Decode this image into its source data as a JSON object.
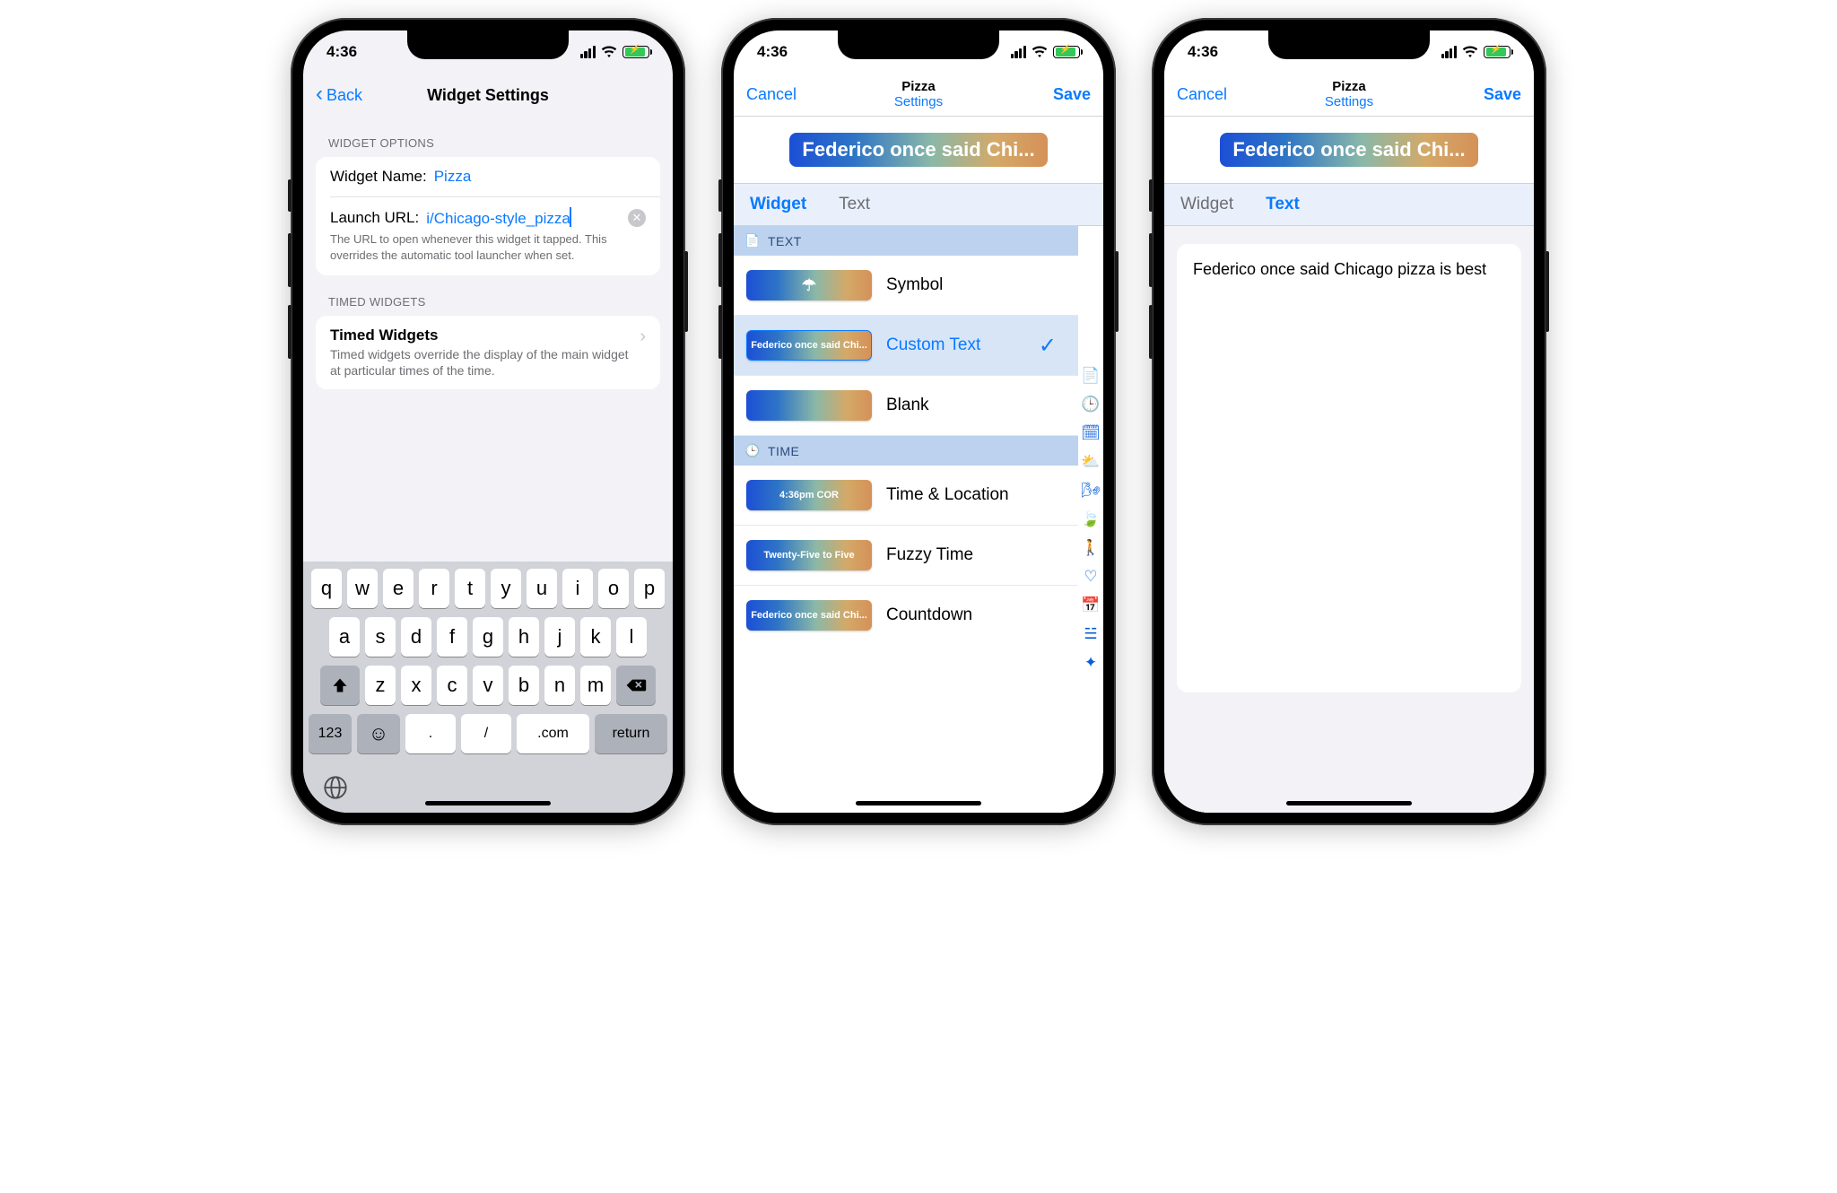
{
  "status": {
    "time": "4:36"
  },
  "phone1": {
    "back": "Back",
    "title": "Widget Settings",
    "section1": "WIDGET OPTIONS",
    "name_label": "Widget Name:",
    "name_value": "Pizza",
    "url_label": "Launch URL:",
    "url_value": "i/Chicago-style_pizza",
    "url_desc": "The URL to open whenever this widget it tapped. This overrides the automatic tool launcher when set.",
    "section2": "TIMED WIDGETS",
    "tw_title": "Timed Widgets",
    "tw_sub": "Timed widgets override the display of the main widget at particular times of the time.",
    "kb": {
      "r1": [
        "q",
        "w",
        "e",
        "r",
        "t",
        "y",
        "u",
        "i",
        "o",
        "p"
      ],
      "r2": [
        "a",
        "s",
        "d",
        "f",
        "g",
        "h",
        "j",
        "k",
        "l"
      ],
      "r3": [
        "z",
        "x",
        "c",
        "v",
        "b",
        "n",
        "m"
      ],
      "r4": {
        "num": "123",
        "dot": ".",
        "slash": "/",
        "com": ".com",
        "ret": "return"
      }
    }
  },
  "phone2": {
    "cancel": "Cancel",
    "save": "Save",
    "title": "Pizza",
    "subtitle": "Settings",
    "preview": "Federico once said Chi...",
    "tabs": {
      "widget": "Widget",
      "text": "Text"
    },
    "sec_text": "TEXT",
    "sec_time": "TIME",
    "rows": {
      "symbol": "Symbol",
      "custom": "Custom Text",
      "custom_thumb": "Federico once said Chi...",
      "blank": "Blank",
      "time_loc": "Time & Location",
      "time_loc_thumb": "4:36pm COR",
      "fuzzy": "Fuzzy Time",
      "fuzzy_thumb": "Twenty-Five to Five",
      "countdown": "Countdown",
      "countdown_thumb": "Federico once said Chi..."
    }
  },
  "phone3": {
    "cancel": "Cancel",
    "save": "Save",
    "title": "Pizza",
    "subtitle": "Settings",
    "preview": "Federico once said Chi...",
    "tabs": {
      "widget": "Widget",
      "text": "Text"
    },
    "text_value": "Federico once said Chicago pizza is best"
  }
}
